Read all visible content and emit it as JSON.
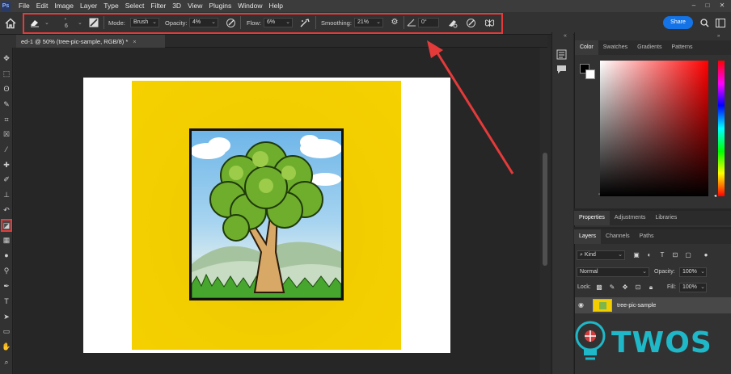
{
  "menubar": {
    "logo": "Ps",
    "items": [
      "File",
      "Edit",
      "Image",
      "Layer",
      "Type",
      "Select",
      "Filter",
      "3D",
      "View",
      "Plugins",
      "Window",
      "Help"
    ]
  },
  "options": {
    "brush_size": "6",
    "mode_label": "Mode:",
    "mode_value": "Brush",
    "opacity_label": "Opacity:",
    "opacity_value": "4%",
    "flow_label": "Flow:",
    "flow_value": "6%",
    "smoothing_label": "Smoothing:",
    "smoothing_value": "21%",
    "angle_value": "0°",
    "share_label": "Share"
  },
  "document": {
    "tab_title": "ed-1 @ 50% (tree-pic-sample, RGB/8) *",
    "close": "×"
  },
  "color_panel": {
    "tabs": [
      "Color",
      "Swatches",
      "Gradients",
      "Patterns"
    ]
  },
  "props_panel": {
    "tabs": [
      "Properties",
      "Adjustments",
      "Libraries"
    ]
  },
  "layers_panel": {
    "tabs": [
      "Layers",
      "Channels",
      "Paths"
    ],
    "kind_label": "Kind",
    "blend_mode": "Normal",
    "opacity_label": "Opacity:",
    "opacity_value": "100%",
    "lock_label": "Lock:",
    "fill_label": "Fill:",
    "fill_value": "100%",
    "layer_name": "tree-pic-sample"
  },
  "watermark": {
    "text": "TWOS"
  },
  "colors": {
    "highlight": "#e53a3a",
    "accent": "#1473e6",
    "canvas_yellow": "#f2cd00",
    "watermark": "#1fb8c8"
  }
}
